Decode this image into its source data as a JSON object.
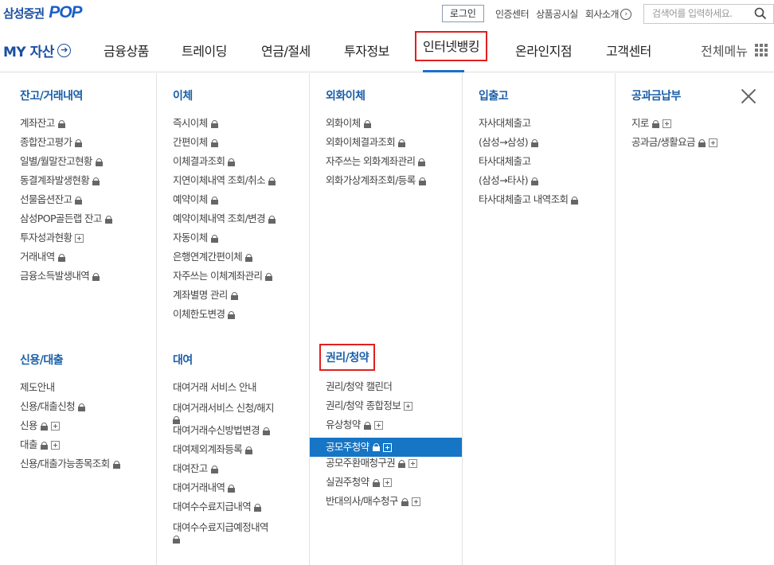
{
  "header": {
    "logo_text": "삼성증권",
    "logo_pop": "POP",
    "login_label": "로그인",
    "util_links": [
      "인증센터",
      "상품공시실",
      "회사소개"
    ],
    "search_placeholder": "검색어를 입력하세요."
  },
  "gnb": {
    "my_asset": "MY 자산",
    "items": [
      "금융상품",
      "트레이딩",
      "연금/절세",
      "투자정보",
      "인터넷뱅킹",
      "온라인지점",
      "고객센터"
    ],
    "active": "인터넷뱅킹",
    "all_menu": "전체메뉴"
  },
  "menu": {
    "balance": {
      "title": "잔고/거래내역",
      "items": [
        {
          "label": "계좌잔고",
          "lock": true
        },
        {
          "label": "종합잔고평가",
          "lock": true
        },
        {
          "label": "일별/월말잔고현황",
          "lock": true
        },
        {
          "label": "동결계좌발생현황",
          "lock": true
        },
        {
          "label": "선물옵션잔고",
          "lock": true
        },
        {
          "label": "삼성POP골든랩 잔고",
          "lock": true
        },
        {
          "label": "투자성과현황",
          "plus": true
        },
        {
          "label": "거래내역",
          "lock": true
        },
        {
          "label": "금융소득발생내역",
          "lock": true
        }
      ]
    },
    "transfer": {
      "title": "이체",
      "items": [
        {
          "label": "즉시이체",
          "lock": true
        },
        {
          "label": "간편이체",
          "lock": true
        },
        {
          "label": "이체결과조회",
          "lock": true
        },
        {
          "label": "지연이체내역 조회/취소",
          "lock": true
        },
        {
          "label": "예약이체",
          "lock": true
        },
        {
          "label": "예약이체내역 조회/변경",
          "lock": true
        },
        {
          "label": "자동이체",
          "lock": true
        },
        {
          "label": "은행연계간편이체",
          "lock": true
        },
        {
          "label": "자주쓰는 이체계좌관리",
          "lock": true
        },
        {
          "label": "계좌별명 관리",
          "lock": true
        },
        {
          "label": "이체한도변경",
          "lock": true
        }
      ]
    },
    "fx": {
      "title": "외화이체",
      "items": [
        {
          "label": "외화이체",
          "lock": true
        },
        {
          "label": "외화이체결과조회",
          "lock": true
        },
        {
          "label": "자주쓰는 외화계좌관리",
          "lock": true
        },
        {
          "label": "외화가상계좌조회/등록",
          "lock": true
        }
      ]
    },
    "inout": {
      "title": "입출고",
      "items": [
        {
          "label": "자사대체출고",
          "lock": false
        },
        {
          "label": "(삼성→삼성)",
          "lock": true
        },
        {
          "label": "타사대체출고",
          "lock": false
        },
        {
          "label": "(삼성→타사)",
          "lock": true
        },
        {
          "label": "타사대체출고 내역조회",
          "lock": true
        }
      ]
    },
    "tax": {
      "title": "공과금납부",
      "items": [
        {
          "label": "지로",
          "lock": true,
          "plus": true
        },
        {
          "label": "공과금/생활요금",
          "lock": true,
          "plus": true
        }
      ]
    },
    "credit": {
      "title": "신용/대출",
      "items": [
        {
          "label": "제도안내"
        },
        {
          "label": "신용/대출신청",
          "lock": true
        },
        {
          "label": "신용",
          "lock": true,
          "plus": true
        },
        {
          "label": "대출",
          "lock": true,
          "plus": true
        },
        {
          "label": "신용/대출가능종목조회",
          "lock": true
        }
      ]
    },
    "lending": {
      "title": "대여",
      "items": [
        {
          "label": "대여거래 서비스 안내"
        },
        {
          "label": "대여거래서비스 신청/해지",
          "lock": true,
          "wrap": true
        },
        {
          "label": "대여거래수신방법변경",
          "lock": true
        },
        {
          "label": "대여제외계좌등록",
          "lock": true
        },
        {
          "label": "대여잔고",
          "lock": true
        },
        {
          "label": "대여거래내역",
          "lock": true
        },
        {
          "label": "대여수수료지급내역",
          "lock": true
        },
        {
          "label": "대여수수료지급예정내역",
          "lock": true,
          "wrap": true
        }
      ]
    },
    "rights": {
      "title": "권리/청약",
      "items": [
        {
          "label": "권리/청약 캘린더"
        },
        {
          "label": "권리/청약 종합정보",
          "plus": true
        },
        {
          "label": "유상청약",
          "lock": true,
          "plus": true
        },
        {
          "label": "공모주청약",
          "lock": true,
          "plus": true,
          "highlight": true
        },
        {
          "label": "공모주환매청구권",
          "lock": true,
          "plus": true
        },
        {
          "label": "실권주청약",
          "lock": true,
          "plus": true
        },
        {
          "label": "반대의사/매수청구",
          "lock": true,
          "plus": true
        }
      ]
    }
  },
  "colors": {
    "accent": "#1a5fa8",
    "highlight": "#1775c5",
    "callout": "#e0201f"
  }
}
